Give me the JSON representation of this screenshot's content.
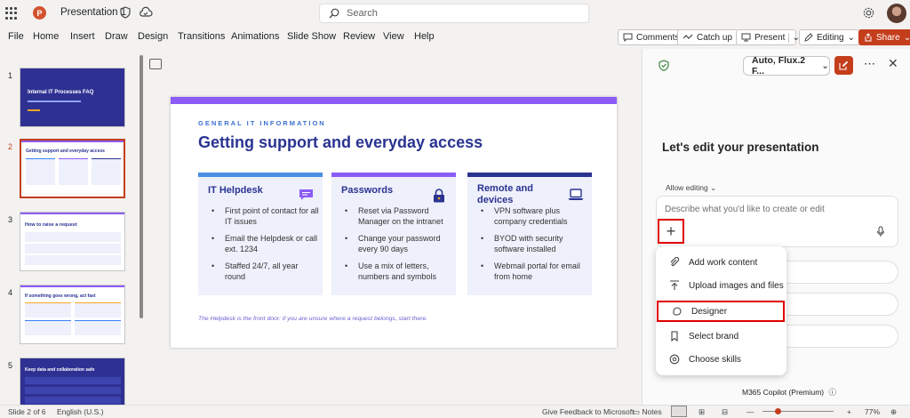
{
  "titlebar": {
    "doc_title": "Presentation 1",
    "search_placeholder": "Search"
  },
  "menu": [
    "File",
    "Home",
    "Insert",
    "Draw",
    "Design",
    "Transitions",
    "Animations",
    "Slide Show",
    "Review",
    "View",
    "Help"
  ],
  "ribbon_right": {
    "comments": "Comments",
    "catchup": "Catch up",
    "present": "Present",
    "editing": "Editing",
    "share": "Share"
  },
  "thumbnails": [
    {
      "num": "1",
      "title": "Internal IT Processes FAQ"
    },
    {
      "num": "2",
      "title": "Getting support and everyday access"
    },
    {
      "num": "3",
      "title": "How to raise a request"
    },
    {
      "num": "4",
      "title": "If something goes wrong, act fast"
    },
    {
      "num": "5",
      "title": "Keep data and collaboration safe"
    }
  ],
  "slide": {
    "kicker": "GENERAL IT INFORMATION",
    "title": "Getting support and everyday access",
    "cards": [
      {
        "heading": "IT Helpdesk",
        "bullets": [
          "First point of contact for all IT issues",
          "Email the Helpdesk or call ext. 1234",
          "Staffed 24/7, all year round"
        ]
      },
      {
        "heading": "Passwords",
        "bullets": [
          "Reset via Password Manager on the intranet",
          "Change your password every 90 days",
          "Use a mix of letters, numbers and symbols"
        ]
      },
      {
        "heading": "Remote and devices",
        "bullets": [
          "VPN software plus company credentials",
          "BYOD with security software installed",
          "Webmail portal for email from home"
        ]
      }
    ],
    "footer": "The Helpdesk is the front door: if you are unsure where a request belongs, start there."
  },
  "pane": {
    "model": "Auto, Flux.2 F...",
    "heading": "Let's edit your presentation",
    "allow": "Allow editing",
    "placeholder": "Describe what you'd like to create or edit",
    "menu": [
      "Add work content",
      "Upload images and files",
      "Designer",
      "Select brand",
      "Choose skills"
    ],
    "footer": "M365 Copilot (Premium)"
  },
  "status": {
    "slide": "Slide 2 of 6",
    "lang": "English (U.S.)",
    "feedback": "Give Feedback to Microsoft",
    "notes": "Notes",
    "zoom": "77%"
  },
  "colors": {
    "accent": "#c43e1c",
    "slide_title": "#2a3391",
    "highlight": "#e00000"
  }
}
